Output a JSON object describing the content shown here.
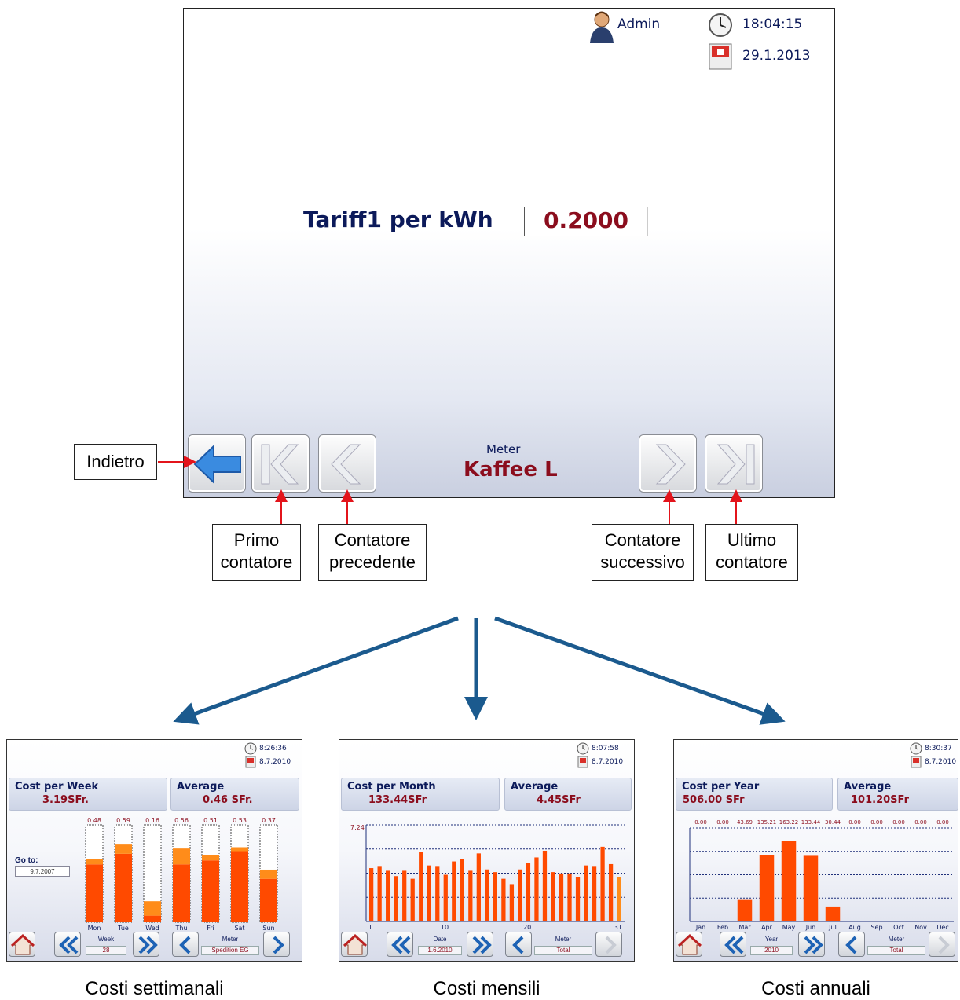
{
  "main": {
    "user": "Admin",
    "time": "18:04:15",
    "date": "29.1.2013",
    "tariff_label": "Tariff1 per kWh",
    "tariff_value": "0.2000",
    "meter_caption": "Meter",
    "meter_name": "Kaffee L"
  },
  "callouts": {
    "back": "Indietro",
    "first": [
      "Primo",
      "contatore"
    ],
    "prev": [
      "Contatore",
      "precedente"
    ],
    "next": [
      "Contatore",
      "successivo"
    ],
    "last": [
      "Ultimo",
      "contatore"
    ]
  },
  "colors": {
    "title_blue": "#0c1a5a",
    "value_red": "#8b0d1d",
    "arrow_blue": "#1b5a8e",
    "bar_orange": "#ff4a00"
  },
  "weekly": {
    "time": "8:26:36",
    "date": "8.7.2010",
    "title": "Cost per Week",
    "value": "3.19SFr.",
    "avg_title": "Average",
    "avg_value": "0.46 SFr.",
    "goto_label": "Go to:",
    "goto_value": "9.7.2007",
    "nav_label": "Week",
    "nav_value": "28",
    "meter_label": "Meter",
    "meter_value": "Spedition EG",
    "caption": "Costi settimanali",
    "chart_data": {
      "type": "bar",
      "categories": [
        "Mon",
        "Tue",
        "Wed",
        "Thu",
        "Fri",
        "Sat",
        "Sun"
      ],
      "value_labels": [
        "0.48",
        "0.59",
        "0.16",
        "0.56",
        "0.51",
        "0.53",
        "0.37"
      ],
      "series": [
        {
          "values": [
            0.44,
            0.52,
            0.05,
            0.44,
            0.47,
            0.54,
            0.33
          ]
        },
        {
          "values": [
            0.04,
            0.07,
            0.11,
            0.12,
            0.04,
            0.03,
            0.07
          ]
        }
      ],
      "ylim": [
        0,
        0.74
      ]
    }
  },
  "monthly": {
    "time": "8:07:58",
    "date": "8.7.2010",
    "title": "Cost per Month",
    "value": "133.44SFr",
    "avg_title": "Average",
    "avg_value": "4.45SFr",
    "nav_label": "Date",
    "nav_value": "1.6.2010",
    "meter_label": "Meter",
    "meter_value": "Total",
    "caption": "Costi mensili",
    "chart_data": {
      "type": "bar",
      "x": [
        1,
        2,
        3,
        4,
        5,
        6,
        7,
        8,
        9,
        10,
        11,
        12,
        13,
        14,
        15,
        16,
        17,
        18,
        19,
        20,
        21,
        22,
        23,
        24,
        25,
        26,
        27,
        28,
        29,
        30,
        31
      ],
      "tick_labels": [
        "1.",
        "10.",
        "20.",
        "31."
      ],
      "y_max_label": "7.24",
      "values": [
        4.0,
        4.1,
        3.8,
        3.4,
        3.8,
        3.2,
        5.2,
        4.2,
        4.1,
        3.5,
        4.5,
        4.7,
        3.8,
        5.1,
        3.9,
        3.7,
        3.2,
        2.8,
        3.9,
        4.4,
        4.8,
        5.3,
        3.7,
        3.6,
        3.6,
        3.3,
        4.2,
        4.1,
        5.6,
        4.3,
        3.3
      ],
      "ylim": [
        0,
        7.24
      ]
    }
  },
  "yearly": {
    "time": "8:30:37",
    "date": "8.7.2010",
    "title": "Cost per Year",
    "value": "506.00 SFr",
    "avg_title": "Average",
    "avg_value": "101.20SFr",
    "nav_label": "Year",
    "nav_value": "2010",
    "meter_label": "Meter",
    "meter_value": "Total",
    "caption": "Costi annuali",
    "chart_data": {
      "type": "bar",
      "categories": [
        "Jan",
        "Feb",
        "Mar",
        "Apr",
        "May",
        "Jun",
        "Jul",
        "Aug",
        "Sep",
        "Oct",
        "Nov",
        "Dec"
      ],
      "value_labels": [
        "0.00",
        "0.00",
        "43.69",
        "135.21",
        "163.22",
        "133.44",
        "30.44",
        "0.00",
        "0.00",
        "0.00",
        "0.00",
        "0.00"
      ],
      "values": [
        0,
        0,
        43.69,
        135.21,
        163.22,
        133.44,
        30.44,
        0,
        0,
        0,
        0,
        0
      ],
      "ylim": [
        0,
        190
      ]
    }
  }
}
